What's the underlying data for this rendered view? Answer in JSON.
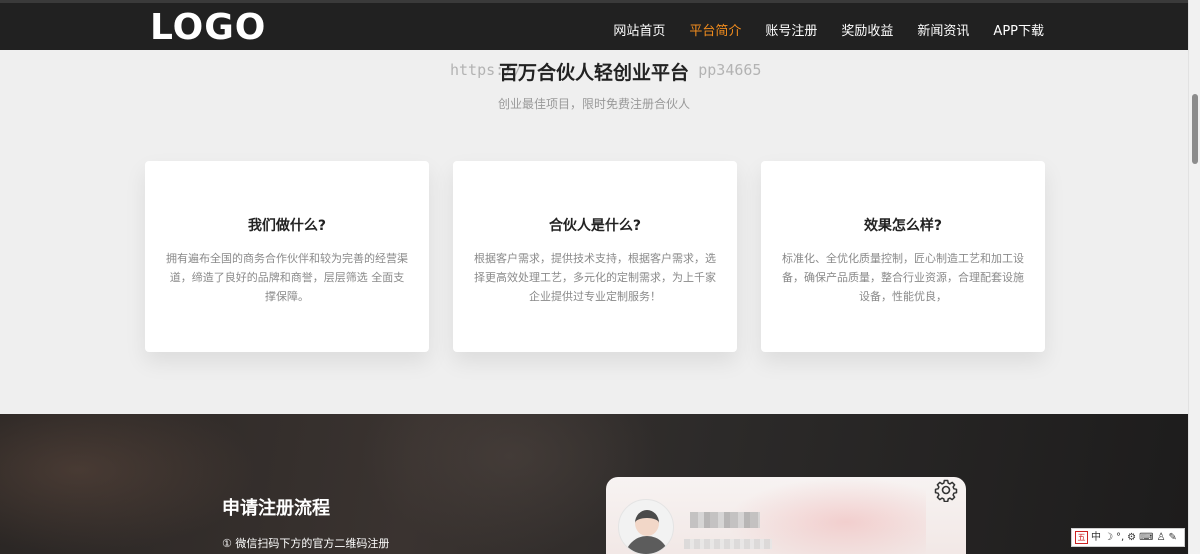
{
  "header": {
    "logo": "LOGO",
    "nav": [
      "网站首页",
      "平台简介",
      "账号注册",
      "奖励收益",
      "新闻资讯",
      "APP下载"
    ],
    "active_index": 1,
    "accent_color": "#f08c1e"
  },
  "intro": {
    "watermark": "https://",
    "watermark_right": "pp34665",
    "title": "百万合伙人轻创业平台",
    "subtitle": "创业最佳项目，限时免费注册合伙人"
  },
  "cards": [
    {
      "title": "我们做什么?",
      "desc": "拥有遍布全国的商务合作伙伴和较为完善的经营渠道，缔造了良好的品牌和商誉，层层筛选 全面支撑保障。"
    },
    {
      "title": "合伙人是什么?",
      "desc": "根据客户需求，提供技术支持，根据客户需求，选择更高效处理工艺，多元化的定制需求，为上千家企业提供过专业定制服务！"
    },
    {
      "title": "效果怎么样?",
      "desc": "标准化、全优化质量控制，匠心制造工艺和加工设备，确保产品质量，整合行业资源，合理配套设施设备，性能优良，"
    }
  ],
  "process": {
    "title": "申请注册流程",
    "step1": "① 微信扫码下方的官方二维码注册"
  },
  "ime": {
    "logo": "五",
    "mode": "中",
    "punct": "°,"
  }
}
